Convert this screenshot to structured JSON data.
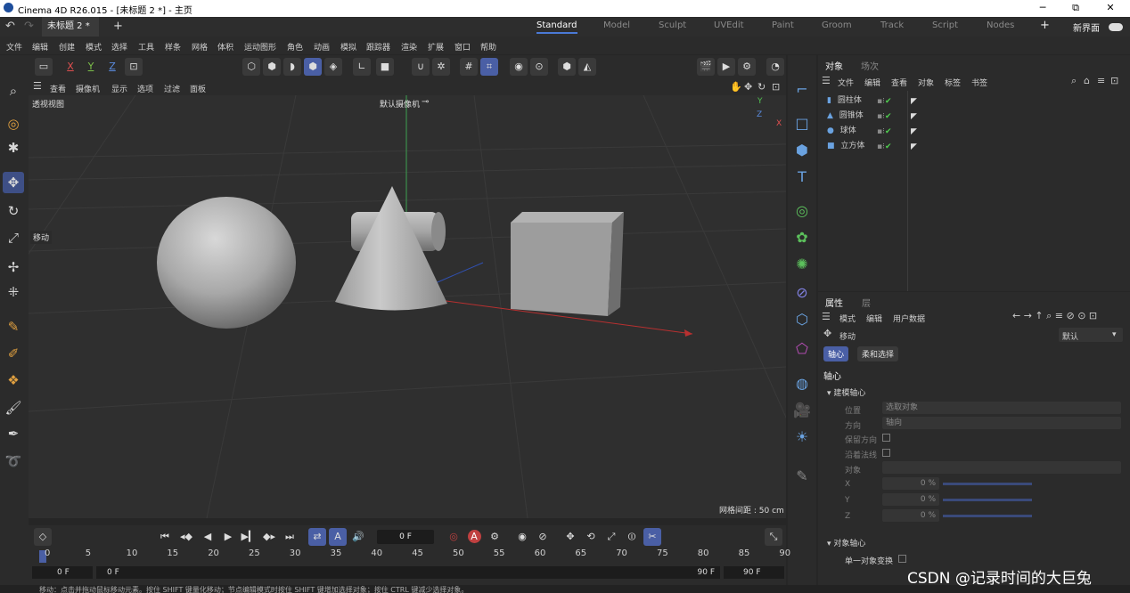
{
  "window": {
    "title": "Cinema 4D R26.015 - [未标题 2 *] - 主页",
    "minimize": "─",
    "maximize": "⧉",
    "close": "✕"
  },
  "tabs": {
    "doc_tab": "未标题 2 *",
    "close_glyph": "×",
    "add": "+",
    "undo": "↶",
    "redo": "↷"
  },
  "layouts": {
    "items": [
      "Standard",
      "Model",
      "Sculpt",
      "UVEdit",
      "Paint",
      "Groom",
      "Track",
      "Script",
      "Nodes"
    ],
    "active": "Standard",
    "add": "+",
    "new_ui": "新界面"
  },
  "menu": {
    "items": [
      "文件",
      "编辑",
      "创建",
      "模式",
      "选择",
      "工具",
      "样条",
      "网格",
      "体积",
      "运动图形",
      "角色",
      "动画",
      "模拟",
      "跟踪器",
      "渲染",
      "扩展",
      "窗口",
      "帮助"
    ]
  },
  "toolbar": {
    "axes": [
      "X",
      "Y",
      "Z"
    ]
  },
  "viewport": {
    "menu": [
      "查看",
      "摄像机",
      "显示",
      "选项",
      "过滤",
      "面板"
    ],
    "name": "透视视图",
    "camera": "默认摄像机",
    "move_label": "移动",
    "grid_spacing": "网格间距 : 50 cm",
    "axis_y": "Y",
    "axis_z": "Z",
    "axis_x": "X"
  },
  "objects": {
    "tabs": [
      "对象",
      "场次"
    ],
    "menu": [
      "文件",
      "编辑",
      "查看",
      "对象",
      "标签",
      "书签"
    ],
    "items": [
      {
        "name": "圆柱体",
        "icon": "cylinder-icon"
      },
      {
        "name": "圆锥体",
        "icon": "cone-icon"
      },
      {
        "name": "球体",
        "icon": "sphere-icon"
      },
      {
        "name": "立方体",
        "icon": "cube-icon"
      }
    ]
  },
  "attributes": {
    "tabs": [
      "属性",
      "层"
    ],
    "menu": [
      "模式",
      "编辑",
      "用户数据"
    ],
    "tool_name": "移动",
    "preset": "默认",
    "subtabs": [
      "轴心",
      "柔和选择"
    ],
    "section": "轴心",
    "group1": "建模轴心",
    "position_label": "位置",
    "position_value": "选取对象",
    "direction_label": "方向",
    "direction_value": "轴向",
    "keep_orient": "保留方向",
    "along_normal": "沿着法线",
    "object_label": "对象",
    "x_label": "X",
    "x_value": "0 %",
    "y_label": "Y",
    "y_value": "0 %",
    "z_label": "Z",
    "z_value": "0 %",
    "group2": "对象轴心",
    "single_obj": "单一对象变换"
  },
  "timeline": {
    "current_frame": "0 F",
    "ticks": [
      "0",
      "5",
      "10",
      "15",
      "20",
      "25",
      "30",
      "35",
      "40",
      "45",
      "50",
      "55",
      "60",
      "65",
      "70",
      "75",
      "80",
      "85",
      "90"
    ],
    "start_field": "0 F",
    "start_field2": "0 F",
    "end_field": "90 F",
    "end_field2": "90 F"
  },
  "status": {
    "text": "移动：点击并拖动鼠标移动元素。按住 SHIFT 键量化移动；节点编辑模式时按住 SHIFT 键增加选择对象；按住 CTRL 键减少选择对象。"
  },
  "watermark": "CSDN @记录时间的大巨兔",
  "colors": {
    "accent": "#4a5fa5",
    "viewport_bg": "#2f2f2f",
    "panel_bg": "#2b2b2b"
  }
}
